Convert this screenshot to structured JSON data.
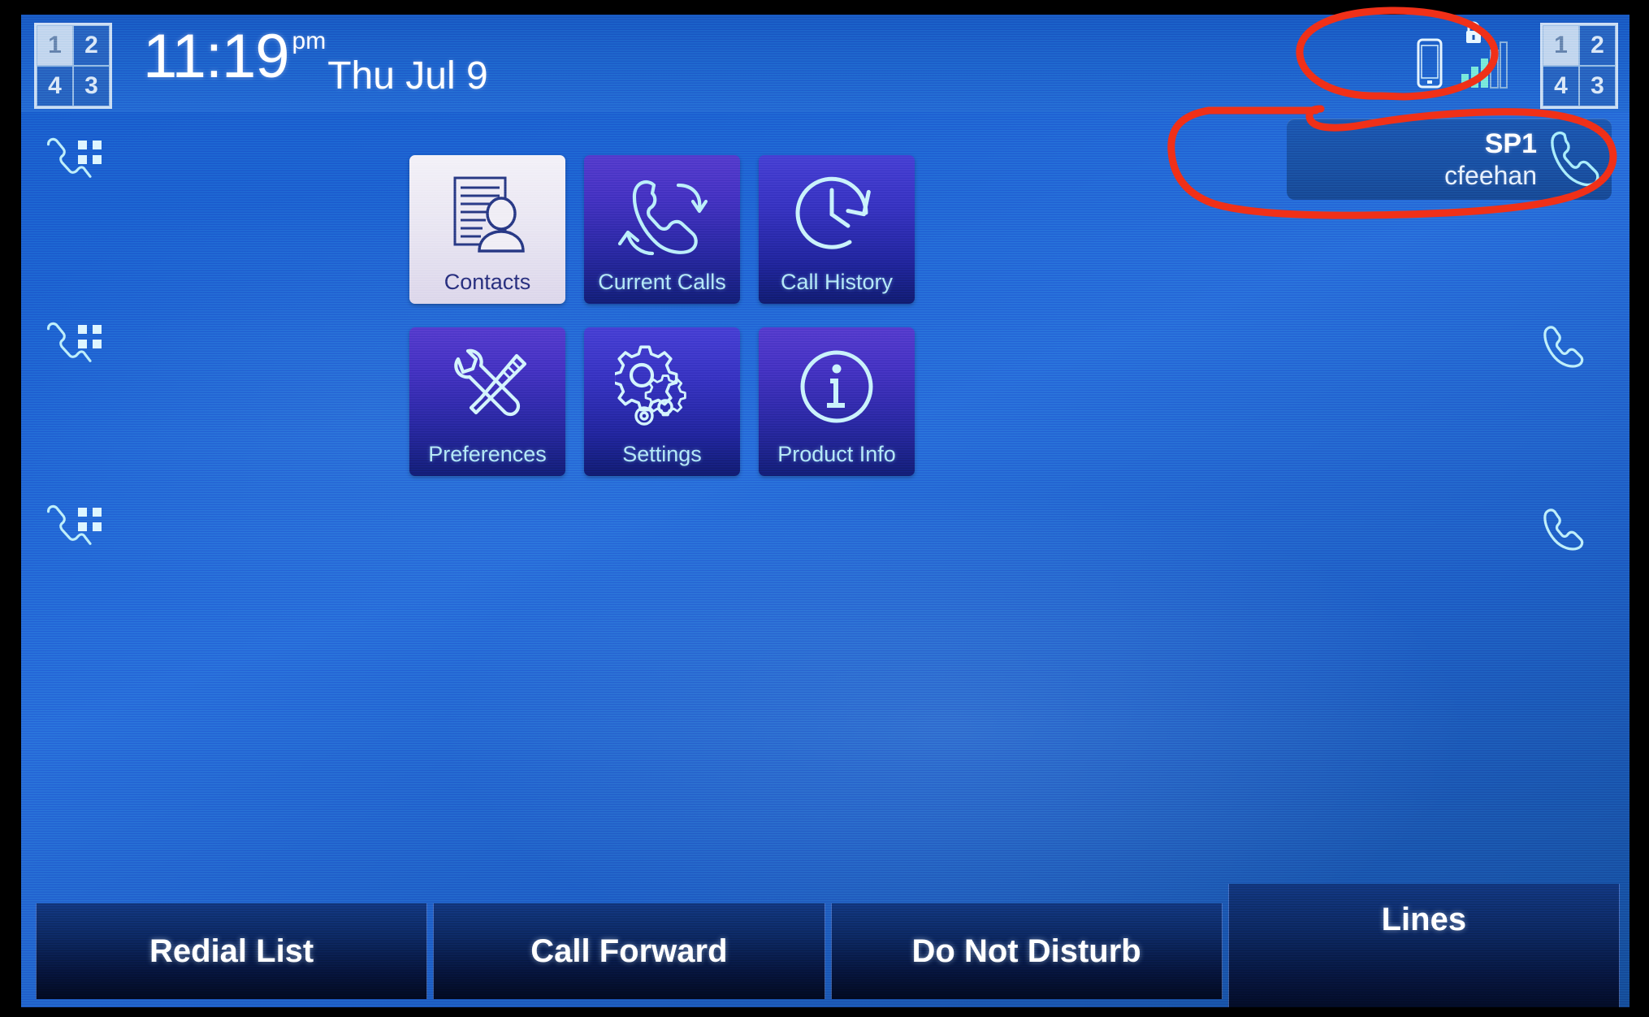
{
  "device": {
    "screen_label": "ip-phone-home-screen"
  },
  "header": {
    "time": "11:19",
    "ampm": "pm",
    "date": "Thu Jul 9",
    "page_indicator_left": [
      "1",
      "2",
      "4",
      "3"
    ],
    "page_indicator_right": [
      "1",
      "2",
      "4",
      "3"
    ],
    "active_page": "1",
    "status_icons": [
      {
        "name": "mobile-phone-icon",
        "label": "Bluetooth / mobile handset"
      },
      {
        "name": "lock-icon",
        "label": "Locked"
      },
      {
        "name": "signal-bars-icon",
        "label": "Signal strength",
        "bars_filled": 3,
        "bars_total": 5
      }
    ]
  },
  "registration": {
    "line_label": "SP1",
    "user": "cfeehan",
    "icon": "handset-icon"
  },
  "line_keys": {
    "left": [
      {
        "name": "line-key-1",
        "icon": "handset-keypad-icon"
      },
      {
        "name": "line-key-2",
        "icon": "handset-keypad-icon"
      },
      {
        "name": "line-key-3",
        "icon": "handset-keypad-icon"
      }
    ],
    "right": [
      {
        "name": "line-key-5",
        "icon": "handset-icon"
      },
      {
        "name": "line-key-6",
        "icon": "handset-icon"
      }
    ]
  },
  "menu": {
    "tiles": [
      {
        "label": "Contacts",
        "icon": "contacts-card-icon",
        "selected": true
      },
      {
        "label": "Current Calls",
        "icon": "active-call-icon",
        "selected": false
      },
      {
        "label": "Call History",
        "icon": "clock-history-icon",
        "selected": false
      },
      {
        "label": "Preferences",
        "icon": "wrench-tools-icon",
        "selected": false
      },
      {
        "label": "Settings",
        "icon": "gears-icon",
        "selected": false
      },
      {
        "label": "Product Info",
        "icon": "info-circle-icon",
        "selected": false
      }
    ]
  },
  "softkeys": [
    {
      "label": "Redial List"
    },
    {
      "label": "Call Forward"
    },
    {
      "label": "Do Not Disturb"
    },
    {
      "label": "Lines"
    }
  ],
  "annotations": {
    "color": "#f03018",
    "marks": [
      {
        "name": "annotation-circle-status-icons",
        "target": "status_icons"
      },
      {
        "name": "annotation-circle-registration",
        "target": "registration"
      }
    ]
  },
  "colors": {
    "screen_blue": "#2069cf",
    "tile_purple": "#3a36c4",
    "tile_selected": "#eae7f3",
    "icon_cyan": "#b9eaf7",
    "softkey_navy": "#0d2a66",
    "annotation_red": "#f03018"
  }
}
